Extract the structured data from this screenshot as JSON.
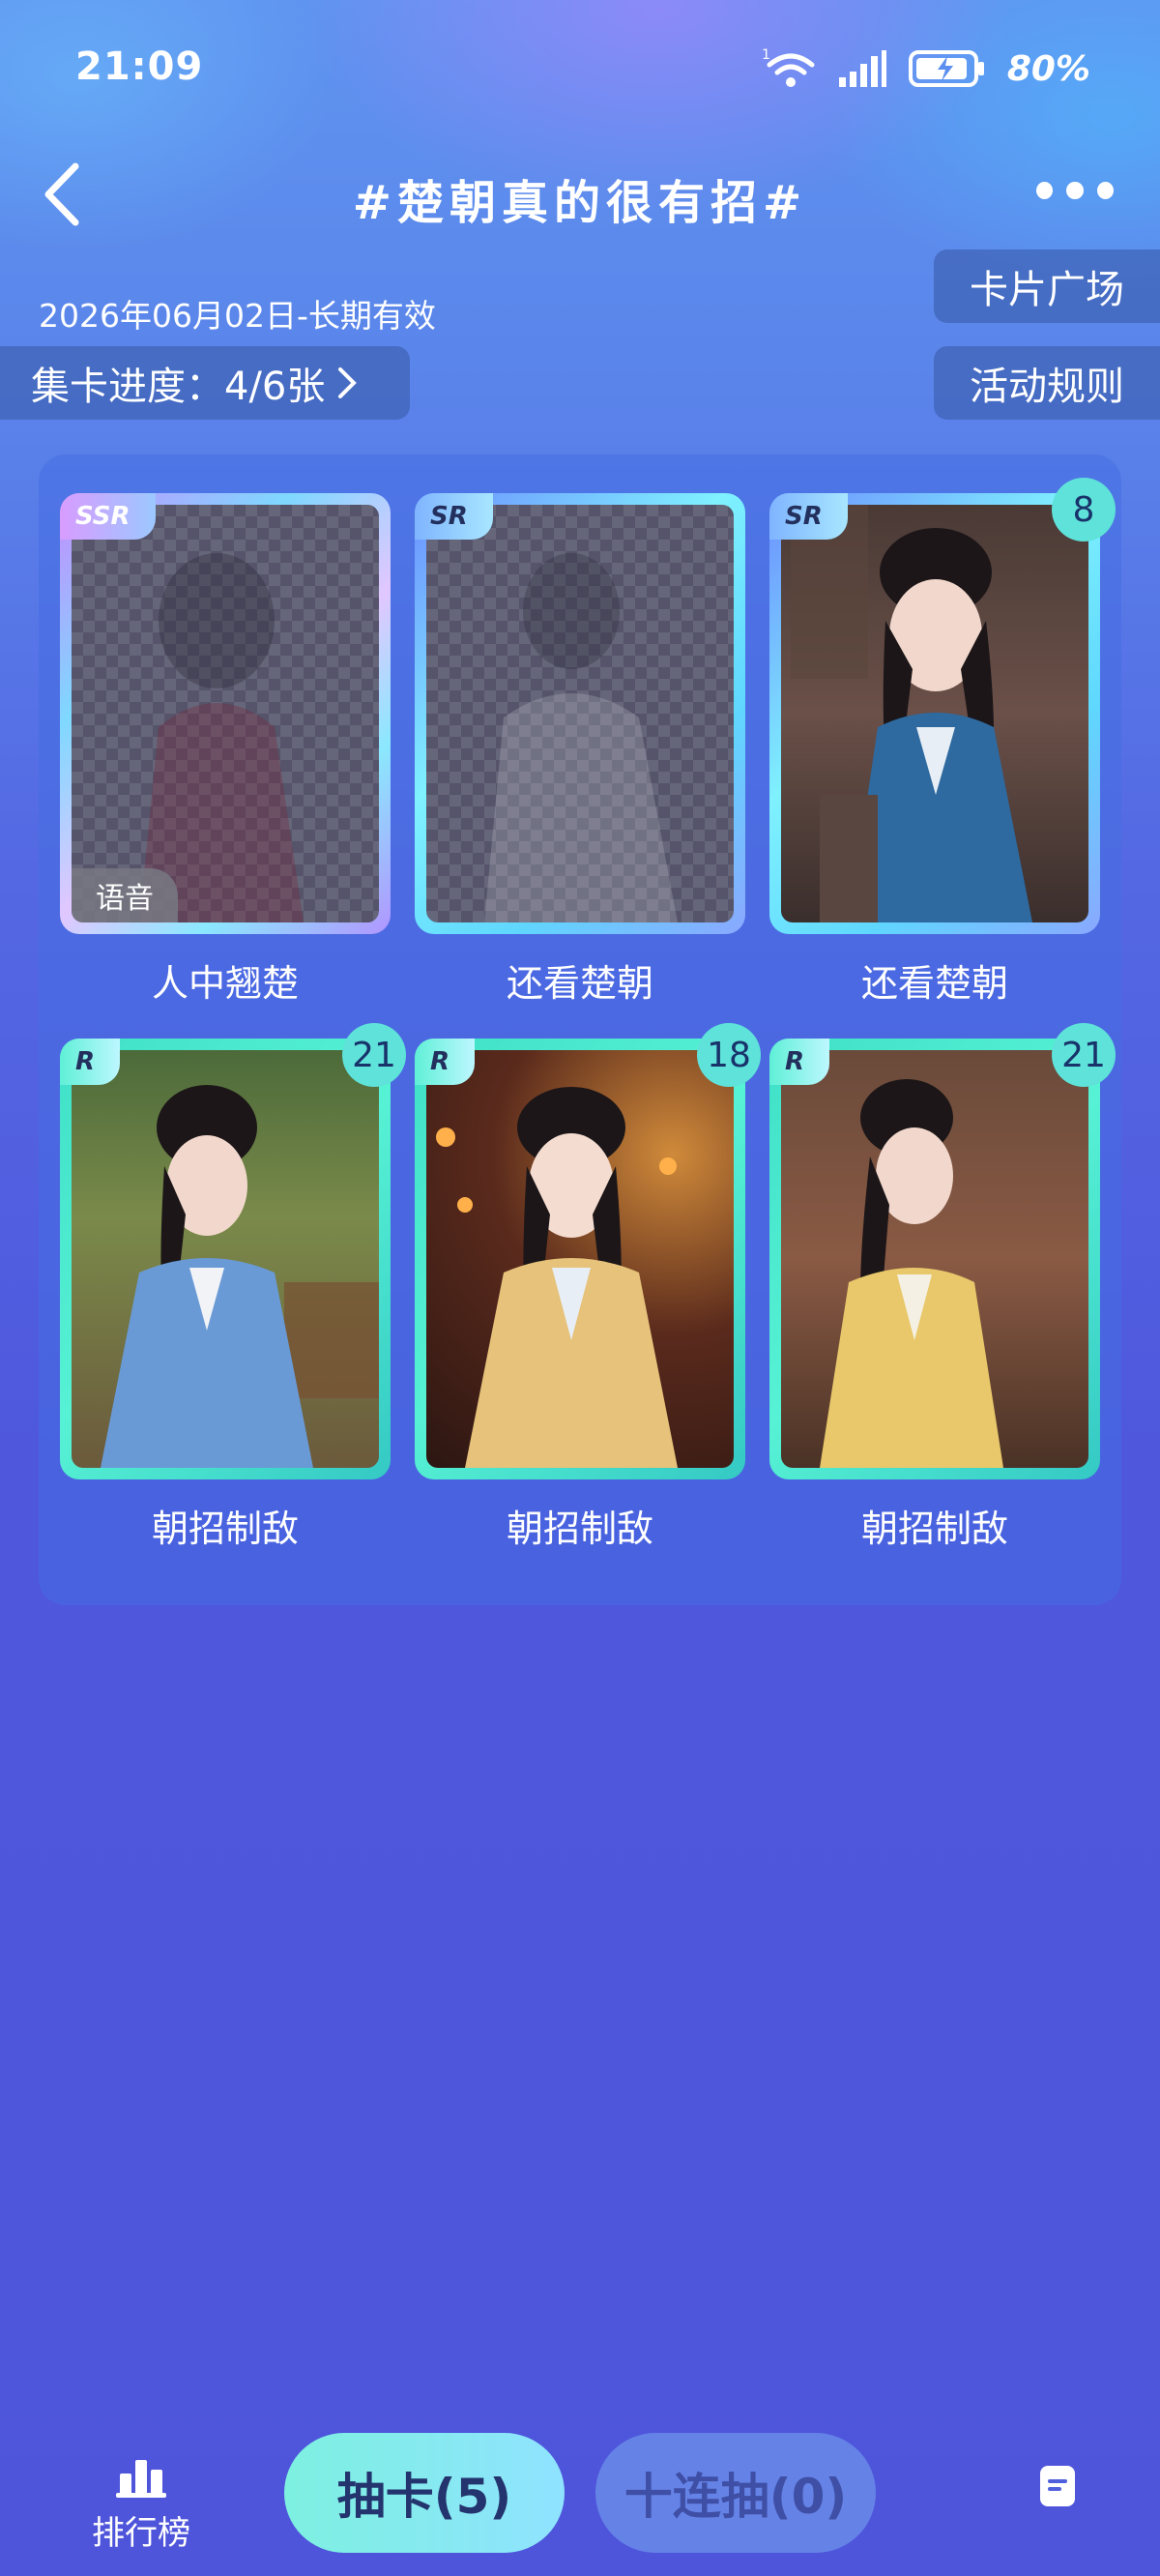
{
  "status": {
    "time": "21:09",
    "battery": "80%"
  },
  "nav": {
    "title": "#楚朝真的很有招#"
  },
  "header": {
    "date_range": "2026年06月02日-长期有效",
    "progress_label": "集卡进度：4/6张",
    "plaza_button": "卡片广场",
    "rules_button": "活动规则"
  },
  "cards": [
    {
      "rarity": "SSR",
      "name": "人中翘楚",
      "count": "",
      "locked": true,
      "tag": "语音"
    },
    {
      "rarity": "SR",
      "name": "还看楚朝",
      "count": "",
      "locked": true,
      "tag": ""
    },
    {
      "rarity": "SR",
      "name": "还看楚朝",
      "count": "8",
      "locked": false,
      "tag": ""
    },
    {
      "rarity": "R",
      "name": "朝招制敌",
      "count": "21",
      "locked": false,
      "tag": ""
    },
    {
      "rarity": "R",
      "name": "朝招制敌",
      "count": "18",
      "locked": false,
      "tag": ""
    },
    {
      "rarity": "R",
      "name": "朝招制敌",
      "count": "21",
      "locked": false,
      "tag": ""
    }
  ],
  "bottom": {
    "rank_label": "排行榜",
    "draw_button": "抽卡(5)",
    "ten_draw_button": "十连抽(0)"
  },
  "colors": {
    "accent_teal": "#5fe2d9",
    "ssr_frame": "#c58cff",
    "sr_frame": "#7ff1ff",
    "r_frame": "#3fe0c8"
  },
  "icons": [
    "back-arrow-icon",
    "more-icon",
    "wifi-icon",
    "signal-icon",
    "battery-icon",
    "rank-chart-icon",
    "note-icon"
  ]
}
